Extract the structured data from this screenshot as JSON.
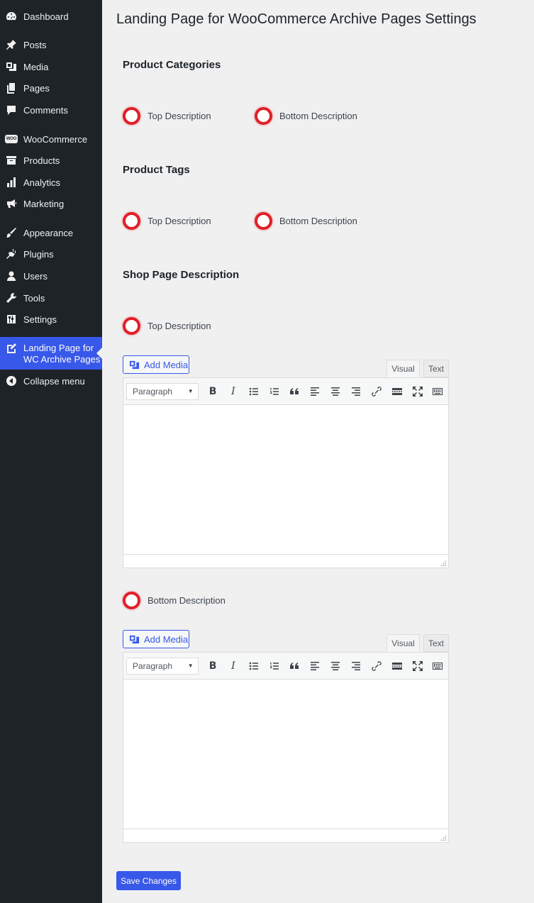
{
  "sidebar": {
    "items": [
      {
        "label": "Dashboard",
        "icon": "dashboard-icon"
      },
      {
        "label": "Posts",
        "icon": "pin-icon"
      },
      {
        "label": "Media",
        "icon": "media-icon"
      },
      {
        "label": "Pages",
        "icon": "pages-icon"
      },
      {
        "label": "Comments",
        "icon": "comment-icon"
      },
      {
        "label": "WooCommerce",
        "icon": "woo-icon",
        "badge": "WOO"
      },
      {
        "label": "Products",
        "icon": "archive-icon"
      },
      {
        "label": "Analytics",
        "icon": "bar-chart-icon"
      },
      {
        "label": "Marketing",
        "icon": "megaphone-icon"
      },
      {
        "label": "Appearance",
        "icon": "paintbrush-icon"
      },
      {
        "label": "Plugins",
        "icon": "plug-icon"
      },
      {
        "label": "Users",
        "icon": "user-icon"
      },
      {
        "label": "Tools",
        "icon": "wrench-icon"
      },
      {
        "label": "Settings",
        "icon": "sliders-icon"
      },
      {
        "label_line1": "Landing Page for",
        "label_line2": "WC Archive Pages",
        "icon": "edit-page-icon",
        "active": true
      },
      {
        "label": "Collapse menu",
        "icon": "collapse-icon"
      }
    ]
  },
  "main": {
    "title": "Landing Page for WooCommerce Archive Pages Settings",
    "sections": {
      "categories": {
        "title": "Product Categories",
        "top": "Top Description",
        "bottom": "Bottom Description"
      },
      "tags": {
        "title": "Product Tags",
        "top": "Top Description",
        "bottom": "Bottom Description"
      },
      "shop": {
        "title": "Shop Page Description",
        "top": "Top Description",
        "bottom": "Bottom Description"
      }
    },
    "editor": {
      "add_media": "Add Media",
      "tab_visual": "Visual",
      "tab_text": "Text",
      "format": "Paragraph"
    },
    "save_label": "Save Changes"
  },
  "colors": {
    "sidebar_bg": "#1d2327",
    "accent": "#3858e9",
    "radio_ring": "#e0202a",
    "page_bg": "#f0f0f1"
  }
}
